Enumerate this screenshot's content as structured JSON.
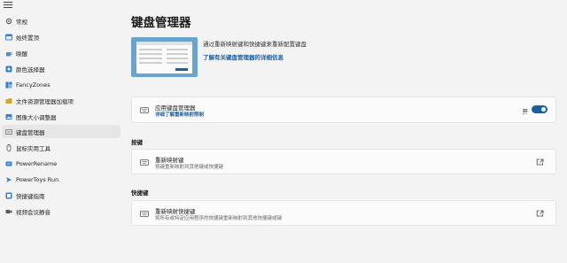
{
  "sidebar": {
    "items": [
      {
        "label": "常规",
        "icon": "gear-icon",
        "color": "#5a5a5a"
      },
      {
        "label": "始终置顶",
        "icon": "pin-window-icon",
        "color": "#3a7bd5"
      },
      {
        "label": "唤醒",
        "icon": "coffee-cup-icon",
        "color": "#4a8fd8"
      },
      {
        "label": "颜色选择器",
        "icon": "color-picker-icon",
        "color": "#2f7fd0"
      },
      {
        "label": "FancyZones",
        "icon": "fancyzones-icon",
        "color": "#2f7fd0"
      },
      {
        "label": "文件资源管理器加载项",
        "icon": "file-explorer-icon",
        "color": "#d8a62b"
      },
      {
        "label": "图像大小调整器",
        "icon": "image-resizer-icon",
        "color": "#3a7bd5"
      },
      {
        "label": "键盘管理器",
        "icon": "keyboard-icon",
        "color": "#6a6a6a"
      },
      {
        "label": "鼠标实用工具",
        "icon": "mouse-icon",
        "color": "#6a6a6a"
      },
      {
        "label": "PowerRename",
        "icon": "powerrename-icon",
        "color": "#2f7fd0"
      },
      {
        "label": "PowerToys Run",
        "icon": "powertoys-run-icon",
        "color": "#2f7fd0"
      },
      {
        "label": "快捷键指南",
        "icon": "shortcut-guide-icon",
        "color": "#2f7fd0"
      },
      {
        "label": "视频会议静音",
        "icon": "video-conference-icon",
        "color": "#5a5a5a"
      }
    ],
    "selected_index": 7
  },
  "main": {
    "title": "键盘管理器",
    "description": "通过重新映射键和快捷键来重新配置键盘",
    "learn_more": "了解有关键盘管理器的详细信息",
    "enable_card": {
      "title": "应用键盘管理器",
      "subtitle": "详细了解重新映射限制",
      "toggle_label": "开",
      "toggle_on": true
    },
    "keys_section": {
      "header": "按键",
      "card_title": "重新映射键",
      "card_subtitle": "将键重新映射到其他键或快捷键"
    },
    "shortcuts_section": {
      "header": "快捷键",
      "card_title": "重新映射快捷键",
      "card_subtitle": "将所有或特定应用程序的快捷键重新映射到其他快捷键或键"
    }
  },
  "colors": {
    "accent": "#1a5fa5",
    "background": "#f3f3f3",
    "card": "#fbfbfb",
    "hero_background": "#6aa4cc"
  }
}
